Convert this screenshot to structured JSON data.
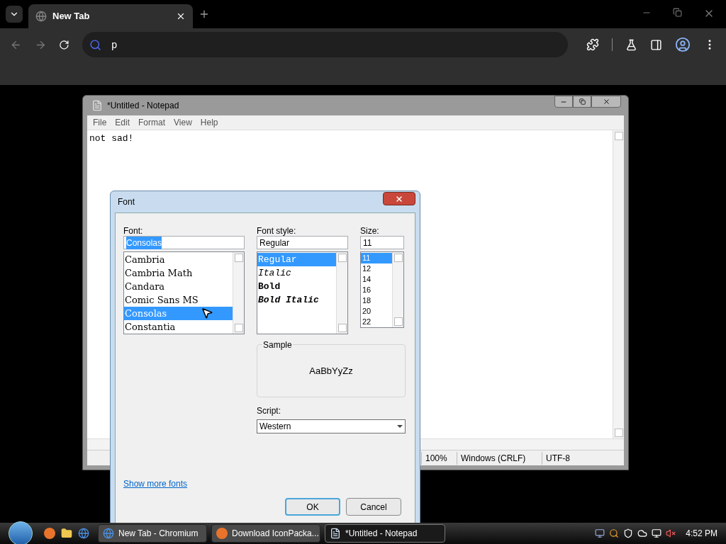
{
  "browser": {
    "tabs": [
      {
        "title": "New Tab",
        "selected": true
      }
    ],
    "address": "p"
  },
  "notepad": {
    "title": "*Untitled - Notepad",
    "menu": [
      "File",
      "Edit",
      "Format",
      "View",
      "Help"
    ],
    "text": "not sad!",
    "status": [
      "100%",
      "Windows (CRLF)",
      "UTF-8"
    ]
  },
  "font_dialog": {
    "title": "Font",
    "font_label": "Font:",
    "font_value": "Consolas",
    "fonts": [
      {
        "label": "Cambria",
        "selected": false
      },
      {
        "label": "Cambria Math",
        "selected": false
      },
      {
        "label": "Candara",
        "selected": false
      },
      {
        "label": "Comic Sans MS",
        "selected": false
      },
      {
        "label": "Consolas",
        "selected": true
      },
      {
        "label": "Constantia",
        "selected": false
      }
    ],
    "style_label": "Font style:",
    "style_value": "Regular",
    "styles": [
      {
        "label": "Regular",
        "kind": "regular",
        "selected": true
      },
      {
        "label": "Italic",
        "kind": "italic",
        "selected": false
      },
      {
        "label": "Bold",
        "kind": "bold",
        "selected": false
      },
      {
        "label": "Bold Italic",
        "kind": "bold_italic",
        "selected": false
      }
    ],
    "size_label": "Size:",
    "size_value": "11",
    "sizes": [
      {
        "label": "11",
        "selected": true
      },
      {
        "label": "12",
        "selected": false
      },
      {
        "label": "14",
        "selected": false
      },
      {
        "label": "16",
        "selected": false
      },
      {
        "label": "18",
        "selected": false
      },
      {
        "label": "20",
        "selected": false
      },
      {
        "label": "22",
        "selected": false
      }
    ],
    "sample_label": "Sample",
    "sample_text": "AaBbYyZz",
    "script_label": "Script:",
    "script_value": "Western",
    "link": "Show more fonts",
    "buttons": [
      {
        "label": "OK",
        "default": true
      },
      {
        "label": "Cancel",
        "default": false
      }
    ]
  },
  "taskbar": {
    "tasks": [
      {
        "label": "New Tab - Chromium",
        "kind": "chromium",
        "selected": false
      },
      {
        "label": "Download IconPacka...",
        "kind": "firefox",
        "selected": false
      },
      {
        "label": "*Untitled - Notepad",
        "kind": "notepad",
        "selected": true
      }
    ],
    "clock": "4:52 PM"
  }
}
